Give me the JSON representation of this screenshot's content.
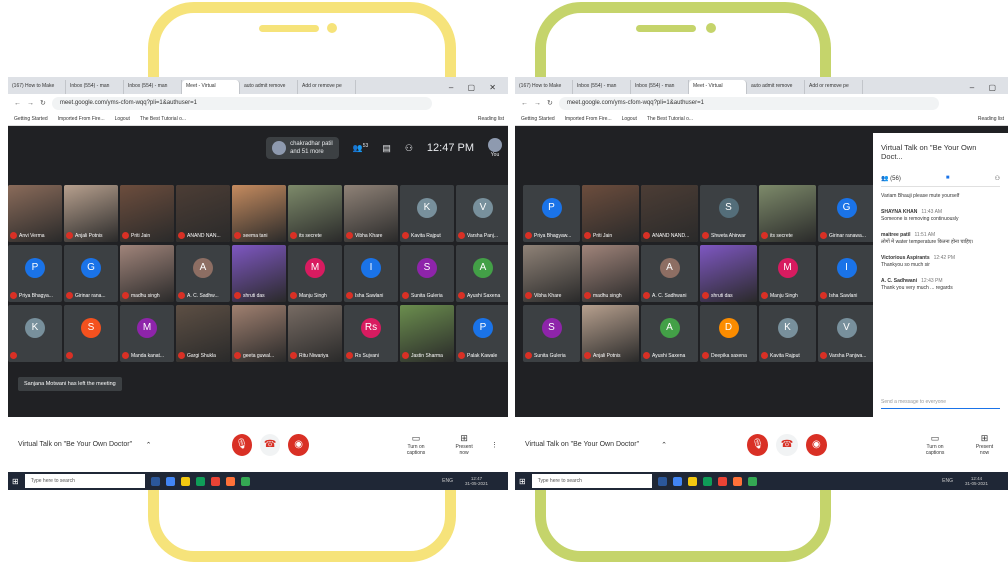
{
  "left": {
    "tabs": [
      "(167) How to Make",
      "Inbox (554) - man",
      "Inbox (554) - man",
      "Meet - Virtual",
      "auto admit remove",
      "Add or remove pe"
    ],
    "url": "meet.google.com/yms-cfom-wqq?pli=1&authuser=1",
    "bookmarks": [
      "Getting Started",
      "Imported From Fire...",
      "Logout",
      "The Best Tutorial o..."
    ],
    "reading_list": "Reading list",
    "chip_name": "chakradhar patil",
    "chip_more": "and 51 more",
    "people_count": "53",
    "time": "12:47 PM",
    "you": "You",
    "participants": [
      {
        "name": "Anvi Verma",
        "initial": "",
        "color": "#8a6b5a"
      },
      {
        "name": "Anjali Potnis",
        "initial": "",
        "color": "#b7a08e"
      },
      {
        "name": "Priti Jain",
        "initial": "",
        "color": "#6c4d3d"
      },
      {
        "name": "ANAND NAN...",
        "initial": "",
        "color": "#4c3d35"
      },
      {
        "name": "seema tani",
        "initial": "",
        "color": "#c58b5f"
      },
      {
        "name": "its secrete",
        "initial": "",
        "color": "#7d8a6a"
      },
      {
        "name": "Vibha Khare",
        "initial": "",
        "color": "#8f8277"
      },
      {
        "name": "Kavita Rajput",
        "initial": "K",
        "color": "#78909c"
      },
      {
        "name": "Varsha Panj...",
        "initial": "V",
        "color": "#78909c"
      },
      {
        "name": "Priya Bhagya...",
        "initial": "P",
        "color": "#1a73e8"
      },
      {
        "name": "Girinar rana...",
        "initial": "G",
        "color": "#1a73e8"
      },
      {
        "name": "madhu singh",
        "initial": "",
        "color": "#a0847a"
      },
      {
        "name": "A. C. Sadhw...",
        "initial": "A",
        "color": "#8d6e63"
      },
      {
        "name": "shruti das",
        "initial": "",
        "color": "#7e57c2"
      },
      {
        "name": "Manju Singh",
        "initial": "M",
        "color": "#d81b60"
      },
      {
        "name": "Isha Sawlani",
        "initial": "I",
        "color": "#1a73e8"
      },
      {
        "name": "Sunita Guleria",
        "initial": "S",
        "color": "#8e24aa"
      },
      {
        "name": "Ayushi Saxena",
        "initial": "A",
        "color": "#43a047"
      },
      {
        "name": "",
        "initial": "K",
        "color": "#78909c"
      },
      {
        "name": "",
        "initial": "S",
        "color": "#f4511e"
      },
      {
        "name": "Manda kanat...",
        "initial": "M",
        "color": "#8e24aa"
      },
      {
        "name": "Gargi Shukla",
        "initial": "",
        "color": "#5d4f44"
      },
      {
        "name": "geeta guwal...",
        "initial": "",
        "color": "#a08070"
      },
      {
        "name": "Ritu Niwariya",
        "initial": "",
        "color": "#776b63"
      },
      {
        "name": "Rs Sujvani",
        "initial": "Rs",
        "color": "#d81b60"
      },
      {
        "name": "Jastin Sharma",
        "initial": "",
        "color": "#6b8e4e"
      },
      {
        "name": "Palak Kawale",
        "initial": "P",
        "color": "#1a73e8"
      }
    ],
    "toast": "Sanjana Motwani has left the meeting",
    "meeting_title": "Virtual Talk on \"Be Your Own Doctor\"",
    "turn_on_captions": "Turn on captions",
    "present_now": "Present now",
    "search_placeholder": "Type here to search",
    "clock_time": "12:47",
    "clock_date": "31-05-2021",
    "lang": "ENG"
  },
  "right": {
    "tabs": [
      "(167) How to Make",
      "Inbox (554) - man",
      "Inbox (554) - man",
      "Meet - Virtual",
      "auto admit remove",
      "Add or remove pe"
    ],
    "url": "meet.google.com/yms-cfom-wqq?pli=1&authuser=1",
    "bookmarks": [
      "Getting Started",
      "Imported From Fire...",
      "Logout",
      "The Best Tutorial o..."
    ],
    "reading_list": "Reading list",
    "participants": [
      {
        "name": "Priya Bhagyaw...",
        "initial": "P",
        "color": "#1a73e8"
      },
      {
        "name": "Priti Jain",
        "initial": "",
        "color": "#6c4d3d"
      },
      {
        "name": "ANAND NAND...",
        "initial": "",
        "color": "#4c3d35"
      },
      {
        "name": "Shweta Ahirwar",
        "initial": "S",
        "color": "#546e7a"
      },
      {
        "name": "its secrete",
        "initial": "",
        "color": "#7d8a6a"
      },
      {
        "name": "Girinar ranawa...",
        "initial": "G",
        "color": "#1a73e8"
      },
      {
        "name": "Vibha Khare",
        "initial": "",
        "color": "#8f8277"
      },
      {
        "name": "madhu singh",
        "initial": "",
        "color": "#a0847a"
      },
      {
        "name": "A. C. Sadhwani",
        "initial": "A",
        "color": "#8d6e63"
      },
      {
        "name": "shruti das",
        "initial": "",
        "color": "#7e57c2"
      },
      {
        "name": "Manju Singh",
        "initial": "M",
        "color": "#d81b60"
      },
      {
        "name": "Isha Sawlani",
        "initial": "I",
        "color": "#1a73e8"
      },
      {
        "name": "Sunita Guleria",
        "initial": "S",
        "color": "#8e24aa"
      },
      {
        "name": "Anjali Potnis",
        "initial": "",
        "color": "#b7a08e"
      },
      {
        "name": "Ayushi Saxena",
        "initial": "A",
        "color": "#43a047"
      },
      {
        "name": "Deepika saxena",
        "initial": "D",
        "color": "#fb8c00"
      },
      {
        "name": "Kavita Rajput",
        "initial": "K",
        "color": "#78909c"
      },
      {
        "name": "Varsha Panjwa...",
        "initial": "V",
        "color": "#78909c"
      }
    ],
    "panel_title": "Virtual Talk on \"Be Your Own Doct...",
    "people_count": "(56)",
    "messages": [
      {
        "sender": "",
        "time": "",
        "text": "Variam Bhauji please mute yourself"
      },
      {
        "sender": "SHAYNA KHAN",
        "time": "11:43 AM",
        "text": "Someone is removing continuously"
      },
      {
        "sender": "maitree patil",
        "time": "11:51 AM",
        "text": "लोगों में water temperature कितना होना चाहिए।"
      },
      {
        "sender": "Victorious Aspirants",
        "time": "12:42 PM",
        "text": "Thankyou so much sir"
      },
      {
        "sender": "A. C. Sadhwani",
        "time": "12:43 PM",
        "text": "Thank you very much ... regards"
      }
    ],
    "send_placeholder": "Send a message to everyone",
    "meeting_title": "Virtual Talk on \"Be Your Own Doctor\"",
    "turn_on_captions": "Turn on captions",
    "present_now": "Present now",
    "search_placeholder": "Type here to search",
    "clock_time": "12:44",
    "clock_date": "31-05-2021",
    "lang": "ENG"
  }
}
